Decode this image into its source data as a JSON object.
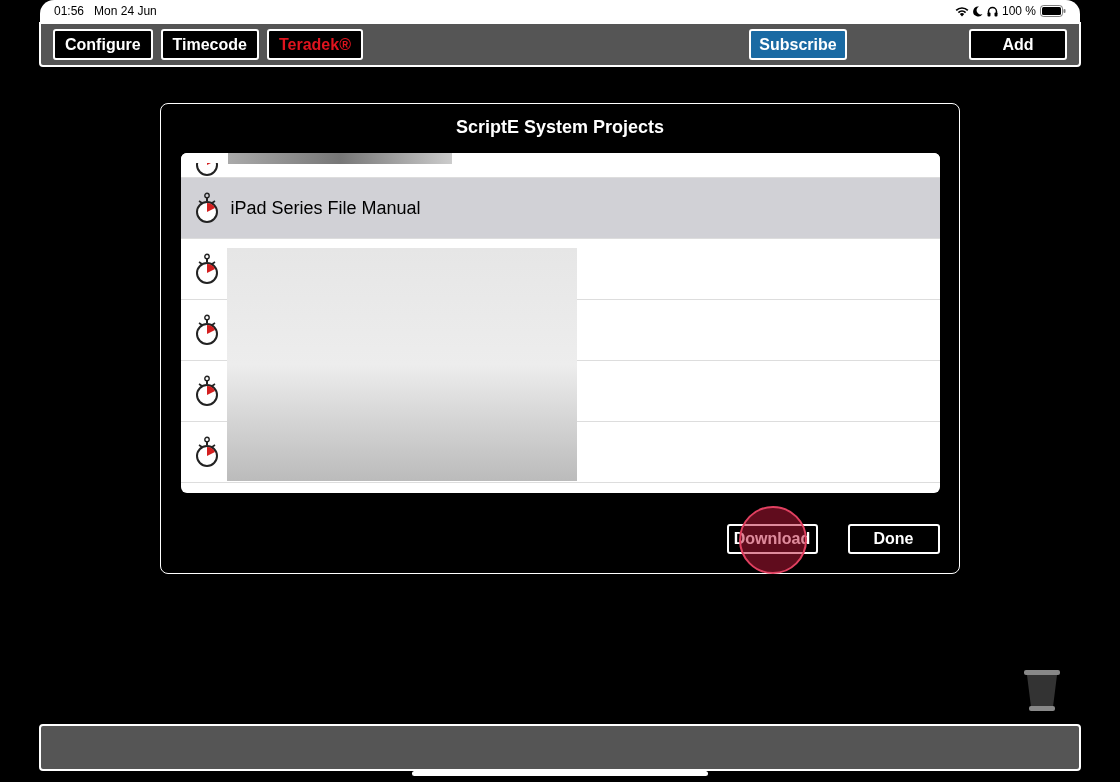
{
  "status_bar": {
    "time": "01:56",
    "date": "Mon 24 Jun",
    "battery": "100 %"
  },
  "toolbar": {
    "buttons": [
      {
        "label": "Configure",
        "kind": "plain"
      },
      {
        "label": "Timecode",
        "kind": "plain"
      },
      {
        "label": "Teradek®",
        "kind": "alert"
      }
    ],
    "subscribe": "Subscribe",
    "add": "Add"
  },
  "dialog": {
    "title": "ScriptE System Projects",
    "rows": [
      {
        "selected": false
      },
      {
        "label": "iPad Series File Manual",
        "selected": true
      },
      {
        "selected": false
      },
      {
        "selected": false
      },
      {
        "selected": false
      },
      {
        "selected": false
      }
    ],
    "buttons": [
      "Download",
      "Done"
    ]
  }
}
